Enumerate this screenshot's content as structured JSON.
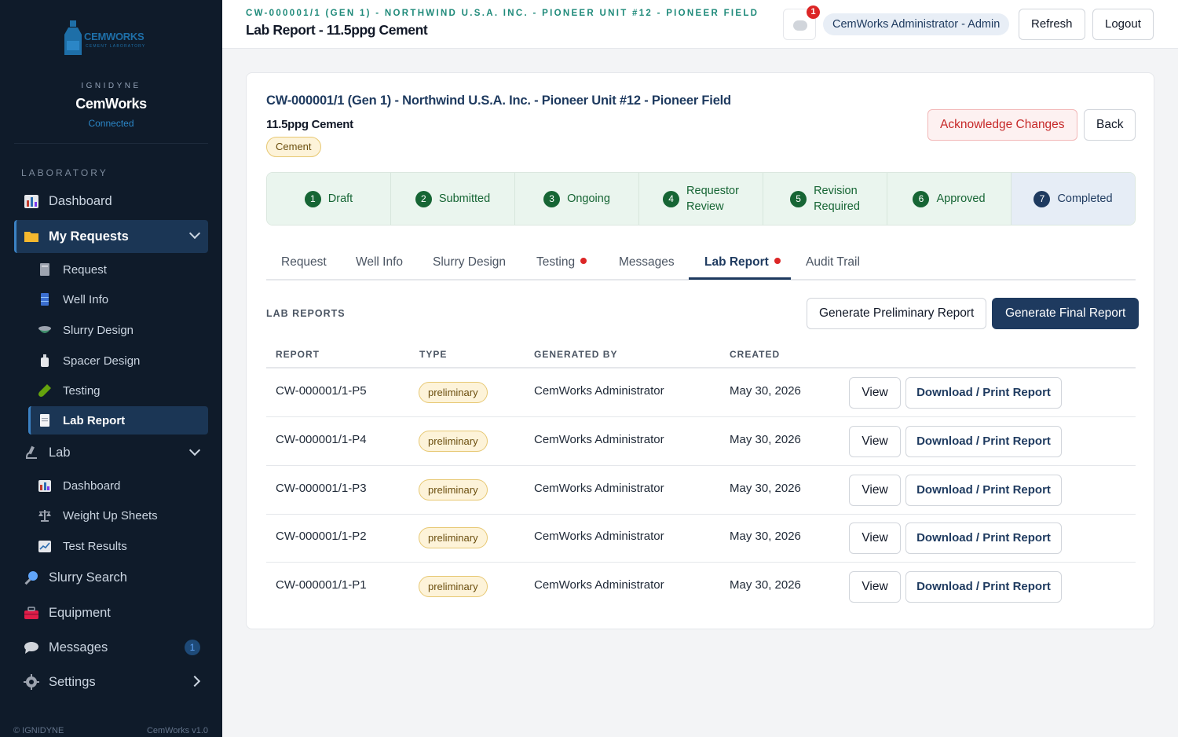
{
  "sidebar": {
    "logo_text": "CEMWORKS",
    "logo_sub": "CEMENT LABORATORY",
    "org": "IGNIDYNE",
    "app_name": "CemWorks",
    "status": "Connected",
    "section": "LABORATORY",
    "items": {
      "dashboard": "Dashboard",
      "my_requests": "My Requests",
      "request": "Request",
      "well_info": "Well Info",
      "slurry_design": "Slurry Design",
      "spacer_design": "Spacer Design",
      "testing": "Testing",
      "lab_report": "Lab Report",
      "lab": "Lab",
      "lab_dashboard": "Dashboard",
      "weight_up": "Weight Up Sheets",
      "test_results": "Test Results",
      "slurry_search": "Slurry Search",
      "equipment": "Equipment",
      "messages": "Messages",
      "messages_count": "1",
      "settings": "Settings"
    },
    "footer_left": "© IGNIDYNE",
    "footer_right": "CemWorks v1.0"
  },
  "topbar": {
    "breadcrumb": "CW-000001/1 (GEN 1) - NORTHWIND U.S.A. INC. - PIONEER UNIT #12 - PIONEER FIELD",
    "title": "Lab Report - 11.5ppg Cement",
    "message_badge": "1",
    "user": "CemWorks Administrator - Admin",
    "refresh": "Refresh",
    "logout": "Logout"
  },
  "card": {
    "title": "CW-000001/1 (Gen 1) - Northwind U.S.A. Inc. - Pioneer Unit #12 - Pioneer Field",
    "subtitle": "11.5ppg Cement",
    "pill": "Cement",
    "acknowledge": "Acknowledge Changes",
    "back": "Back"
  },
  "steps": [
    {
      "num": "1",
      "label": "Draft"
    },
    {
      "num": "2",
      "label": "Submitted"
    },
    {
      "num": "3",
      "label": "Ongoing"
    },
    {
      "num": "4",
      "label": "Requestor",
      "label2": "Review"
    },
    {
      "num": "5",
      "label": "Revision",
      "label2": "Required"
    },
    {
      "num": "6",
      "label": "Approved"
    },
    {
      "num": "7",
      "label": "Completed"
    }
  ],
  "tabs": {
    "request": "Request",
    "well_info": "Well Info",
    "slurry_design": "Slurry Design",
    "testing": "Testing",
    "messages": "Messages",
    "lab_report": "Lab Report",
    "audit_trail": "Audit Trail"
  },
  "reports": {
    "section_label": "LAB REPORTS",
    "gen_preliminary": "Generate Preliminary Report",
    "gen_final": "Generate Final Report",
    "columns": {
      "report": "REPORT",
      "type": "TYPE",
      "generated_by": "GENERATED BY",
      "created": "CREATED"
    },
    "view_label": "View",
    "download_label": "Download / Print Report",
    "rows": [
      {
        "id": "CW-000001/1-P5",
        "type": "preliminary",
        "by": "CemWorks Administrator",
        "created": "May 30, 2026"
      },
      {
        "id": "CW-000001/1-P4",
        "type": "preliminary",
        "by": "CemWorks Administrator",
        "created": "May 30, 2026"
      },
      {
        "id": "CW-000001/1-P3",
        "type": "preliminary",
        "by": "CemWorks Administrator",
        "created": "May 30, 2026"
      },
      {
        "id": "CW-000001/1-P2",
        "type": "preliminary",
        "by": "CemWorks Administrator",
        "created": "May 30, 2026"
      },
      {
        "id": "CW-000001/1-P1",
        "type": "preliminary",
        "by": "CemWorks Administrator",
        "created": "May 30, 2026"
      }
    ]
  },
  "colors": {
    "sidebar_bg": "#0f1b2a",
    "accent": "#1e3a5f",
    "step_green": "#166534",
    "alert_red": "#dc2626"
  }
}
